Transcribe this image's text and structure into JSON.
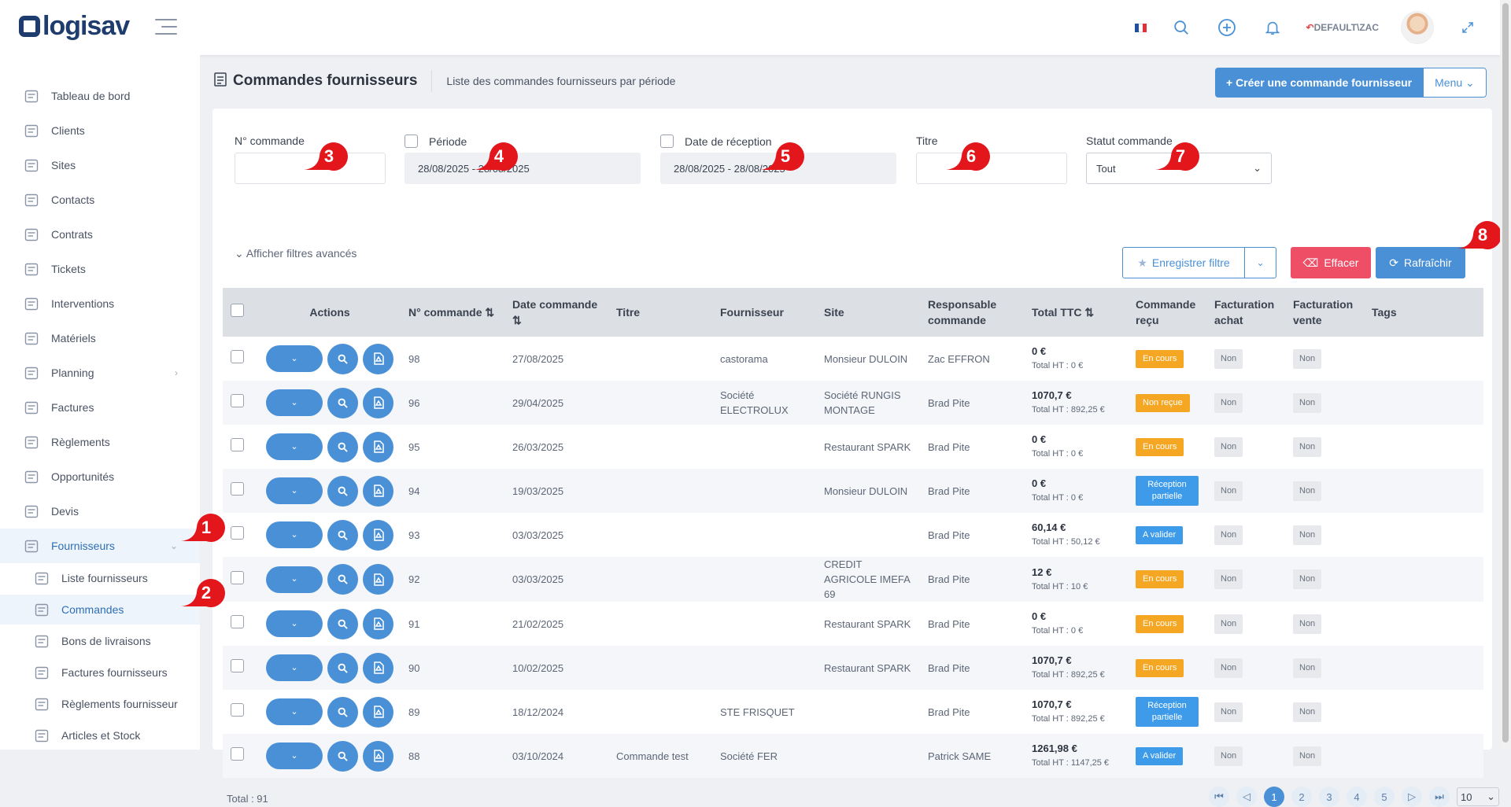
{
  "app": {
    "logo": "logisav"
  },
  "topbar": {
    "user_label": "DEFAULT\\ZAC",
    "flag_colors": [
      "#1f4fa0",
      "#ffffff",
      "#e0303a"
    ]
  },
  "sidebar": {
    "items": [
      {
        "label": "Tableau de bord",
        "icon": "dashboard-icon"
      },
      {
        "label": "Clients",
        "icon": "clients-icon"
      },
      {
        "label": "Sites",
        "icon": "location-icon"
      },
      {
        "label": "Contacts",
        "icon": "contacts-icon"
      },
      {
        "label": "Contrats",
        "icon": "contract-icon"
      },
      {
        "label": "Tickets",
        "icon": "warning-icon"
      },
      {
        "label": "Interventions",
        "icon": "wrench-icon"
      },
      {
        "label": "Matériels",
        "icon": "box-icon"
      },
      {
        "label": "Planning",
        "icon": "calendar-icon",
        "chevron": "›"
      },
      {
        "label": "Factures",
        "icon": "invoice-icon"
      },
      {
        "label": "Règlements",
        "icon": "payments-icon"
      },
      {
        "label": "Opportunités",
        "icon": "opportunities-icon"
      },
      {
        "label": "Devis",
        "icon": "quote-icon"
      },
      {
        "label": "Fournisseurs",
        "icon": "truck-icon",
        "chevron": "⌄"
      }
    ],
    "subitems": [
      {
        "label": "Liste fournisseurs",
        "icon": "truck-icon"
      },
      {
        "label": "Commandes",
        "icon": "order-icon"
      },
      {
        "label": "Bons de livraisons",
        "icon": "delivery-icon"
      },
      {
        "label": "Factures fournisseurs",
        "icon": "invoice-icon"
      },
      {
        "label": "Règlements fournisseur",
        "icon": "payments-icon"
      },
      {
        "label": "Articles et Stock",
        "icon": "stock-icon"
      }
    ]
  },
  "page": {
    "title": "Commandes fournisseurs",
    "subtitle": "Liste des commandes fournisseurs par période",
    "create_label": "+ Créer une commande fournisseur",
    "menu_label": "Menu ⌄"
  },
  "filters": {
    "num_label": "N° commande",
    "period_label": "Période",
    "period_value": "28/08/2025 - 28/08/2025",
    "reception_label": "Date de réception",
    "reception_value": "28/08/2025 - 28/08/2025",
    "title_label": "Titre",
    "status_label": "Statut commande",
    "status_value": "Tout",
    "advanced_label": "⌄ Afficher filtres avancés",
    "save_label": "Enregistrer filtre",
    "clear_label": "Effacer",
    "refresh_label": "Rafraîchir"
  },
  "markers": [
    "1",
    "2",
    "3",
    "4",
    "5",
    "6",
    "7",
    "8"
  ],
  "table": {
    "headers": {
      "actions": "Actions",
      "num": "N° commande ⇅",
      "date": "Date commande ⇅",
      "titre": "Titre",
      "fournisseur": "Fournisseur",
      "site": "Site",
      "responsable": "Responsable commande",
      "total": "Total TTC ⇅",
      "recu": "Commande reçu",
      "fact_achat": "Facturation achat",
      "fact_vente": "Facturation vente",
      "tags": "Tags"
    },
    "rows": [
      {
        "num": "98",
        "date": "27/08/2025",
        "titre": "",
        "fournisseur": "castorama",
        "site": "Monsieur DULOIN",
        "responsable": "Zac EFFRON",
        "ttc": "0 €",
        "ht": "Total HT : 0 €",
        "status": "En cours",
        "status_color": "#f5a623",
        "achat": "Non",
        "vente": "Non"
      },
      {
        "num": "96",
        "date": "29/04/2025",
        "titre": "",
        "fournisseur": "Société ELECTROLUX",
        "site": "Société RUNGIS MONTAGE",
        "responsable": "Brad Pite",
        "ttc": "1070,7 €",
        "ht": "Total HT : 892,25 €",
        "status": "Non reçue",
        "status_color": "#f5a623",
        "achat": "Non",
        "vente": "Non"
      },
      {
        "num": "95",
        "date": "26/03/2025",
        "titre": "",
        "fournisseur": "",
        "site": "Restaurant SPARK",
        "responsable": "Brad Pite",
        "ttc": "0 €",
        "ht": "Total HT : 0 €",
        "status": "En cours",
        "status_color": "#f5a623",
        "achat": "Non",
        "vente": "Non"
      },
      {
        "num": "94",
        "date": "19/03/2025",
        "titre": "",
        "fournisseur": "",
        "site": "Monsieur DULOIN",
        "responsable": "Brad Pite",
        "ttc": "0 €",
        "ht": "Total HT : 0 €",
        "status": "Réception partielle",
        "status_color": "#3d9be9",
        "achat": "Non",
        "vente": "Non"
      },
      {
        "num": "93",
        "date": "03/03/2025",
        "titre": "",
        "fournisseur": "",
        "site": "",
        "responsable": "Brad Pite",
        "ttc": "60,14 €",
        "ht": "Total HT : 50,12 €",
        "status": "A valider",
        "status_color": "#3d9be9",
        "achat": "Non",
        "vente": "Non"
      },
      {
        "num": "92",
        "date": "03/03/2025",
        "titre": "",
        "fournisseur": "",
        "site": "CREDIT AGRICOLE IMEFA 69",
        "responsable": "Brad Pite",
        "ttc": "12 €",
        "ht": "Total HT : 10 €",
        "status": "En cours",
        "status_color": "#f5a623",
        "achat": "Non",
        "vente": "Non"
      },
      {
        "num": "91",
        "date": "21/02/2025",
        "titre": "",
        "fournisseur": "",
        "site": "Restaurant SPARK",
        "responsable": "Brad Pite",
        "ttc": "0 €",
        "ht": "Total HT : 0 €",
        "status": "En cours",
        "status_color": "#f5a623",
        "achat": "Non",
        "vente": "Non"
      },
      {
        "num": "90",
        "date": "10/02/2025",
        "titre": "",
        "fournisseur": "",
        "site": "Restaurant SPARK",
        "responsable": "Brad Pite",
        "ttc": "1070,7 €",
        "ht": "Total HT : 892,25 €",
        "status": "En cours",
        "status_color": "#f5a623",
        "achat": "Non",
        "vente": "Non"
      },
      {
        "num": "89",
        "date": "18/12/2024",
        "titre": "",
        "fournisseur": "STE FRISQUET",
        "site": "",
        "responsable": "Brad Pite",
        "ttc": "1070,7 €",
        "ht": "Total HT : 892,25 €",
        "status": "Réception partielle",
        "status_color": "#3d9be9",
        "achat": "Non",
        "vente": "Non"
      },
      {
        "num": "88",
        "date": "03/10/2024",
        "titre": "Commande test",
        "fournisseur": "Société FER",
        "site": "",
        "responsable": "Patrick SAME",
        "ttc": "1261,98 €",
        "ht": "Total HT : 1147,25 €",
        "status": "A valider",
        "status_color": "#3d9be9",
        "achat": "Non",
        "vente": "Non"
      }
    ]
  },
  "footer": {
    "total": "Total : 91",
    "pages": [
      "1",
      "2",
      "3",
      "4",
      "5"
    ],
    "page_size": "10"
  }
}
